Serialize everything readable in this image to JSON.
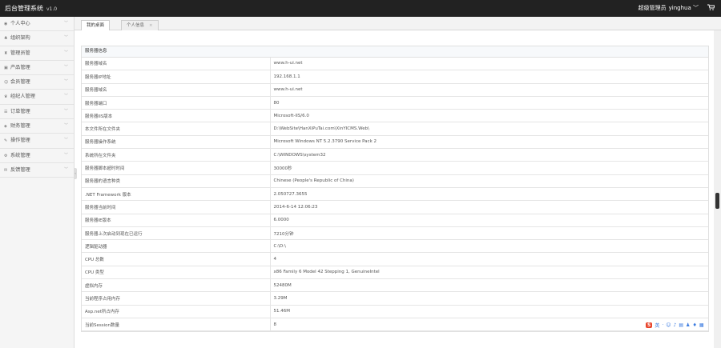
{
  "header": {
    "app_title": "后台管理系统",
    "version": "v1.0",
    "role": "超级管理员",
    "username": "yinghua",
    "dropdown_glyph": "﹀",
    "cart_icon": "cart-icon"
  },
  "sidebar": {
    "items": [
      {
        "label": "个人中心",
        "icon": "user-icon"
      },
      {
        "label": "组织架构",
        "icon": "org-icon"
      },
      {
        "label": "管理员管",
        "icon": "admin-icon"
      },
      {
        "label": "产品管理",
        "icon": "product-icon"
      },
      {
        "label": "会员管理",
        "icon": "member-icon"
      },
      {
        "label": "经纪人管理",
        "icon": "agent-icon"
      },
      {
        "label": "订单管理",
        "icon": "order-icon"
      },
      {
        "label": "财务管理",
        "icon": "finance-icon"
      },
      {
        "label": "操作管理",
        "icon": "operation-icon"
      },
      {
        "label": "系统管理",
        "icon": "system-icon"
      },
      {
        "label": "反馈管理",
        "icon": "feedback-icon"
      }
    ]
  },
  "tabs": [
    {
      "label": "我的桌面",
      "active": true
    },
    {
      "label": "个人信息",
      "active": false,
      "close": "×"
    }
  ],
  "panel": {
    "title": "服务器信息",
    "rows": [
      {
        "key": "服务器域名",
        "value": "www.h-ui.net"
      },
      {
        "key": "服务器IP地址",
        "value": "192.168.1.1"
      },
      {
        "key": "服务器域名",
        "value": "www.h-ui.net"
      },
      {
        "key": "服务器端口",
        "value": "80"
      },
      {
        "key": "服务器IIS版本",
        "value": "Microsoft-IIS/6.0"
      },
      {
        "key": "本文件所在文件夹",
        "value": "D:\\WebSite\\HanXiPuTai.com\\XinYICMS.Web\\"
      },
      {
        "key": "服务器操作系统",
        "value": "Microsoft Windows NT 5.2.3790 Service Pack 2"
      },
      {
        "key": "系统所在文件夹",
        "value": "C:\\WINDOWS\\system32"
      },
      {
        "key": "服务器脚本超时时间",
        "value": "30000秒"
      },
      {
        "key": "服务器的语言种类",
        "value": "Chinese (People's Republic of China)"
      },
      {
        "key": ".NET Framework 版本",
        "value": "2.050727.3655"
      },
      {
        "key": "服务器当前时间",
        "value": "2014-6-14 12:06:23"
      },
      {
        "key": "服务器IE版本",
        "value": "6.0000"
      },
      {
        "key": "服务器上次启动到现在已运行",
        "value": "7210分钟"
      },
      {
        "key": "逻辑驱动器",
        "value": "C:\\D:\\"
      },
      {
        "key": "CPU 总数",
        "value": "4"
      },
      {
        "key": "CPU 类型",
        "value": "x86 Family 6 Model 42 Stepping 1, GenuineIntel"
      },
      {
        "key": "虚拟内存",
        "value": "52480M"
      },
      {
        "key": "当前程序占用内存",
        "value": "3.29M"
      },
      {
        "key": "Asp.net所占内存",
        "value": "51.46M"
      },
      {
        "key": "当前Session数量",
        "value": "8"
      }
    ]
  },
  "ime_toolbar": {
    "logo": "S",
    "mode": "英",
    "icons": [
      "dot-icon",
      "smile-icon",
      "mic-icon",
      "keyboard-icon",
      "person-icon",
      "shirt-icon",
      "grid-icon"
    ]
  }
}
